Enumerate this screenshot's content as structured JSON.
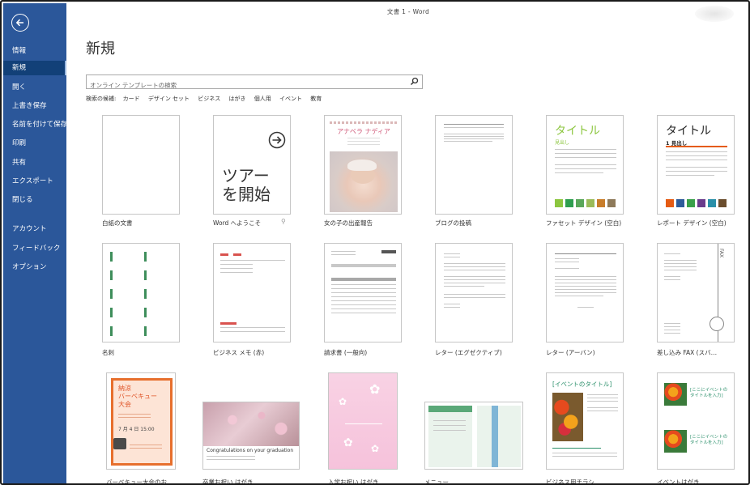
{
  "sidebar": {
    "back_label": "",
    "items": [
      {
        "label": "情報"
      },
      {
        "label": "新規"
      },
      {
        "label": "開く"
      },
      {
        "label": "上書き保存"
      },
      {
        "label": "名前を付けて保存"
      },
      {
        "label": "印刷"
      },
      {
        "label": "共有"
      },
      {
        "label": "エクスポート"
      },
      {
        "label": "閉じる"
      },
      {
        "label": "アカウント"
      },
      {
        "label": "フィードバック"
      },
      {
        "label": "オプション"
      }
    ],
    "active": "新規"
  },
  "window": {
    "title": "文書 1 - Word"
  },
  "page": {
    "title": "新規"
  },
  "search": {
    "placeholder": "オンライン テンプレートの検索"
  },
  "suggestions": {
    "label": "検索の候補:",
    "items": [
      "カード",
      "デザイン セット",
      "ビジネス",
      "はがき",
      "個人用",
      "イベント",
      "教育"
    ]
  },
  "templates": [
    {
      "label": "白紙の文書"
    },
    {
      "label": "Word へようこそ",
      "thumb_text_1": "ツアー",
      "thumb_text_2": "を開始"
    },
    {
      "label": "女の子の出産報告",
      "thumb_name": "アナベラ ナディア"
    },
    {
      "label": "ブログの投稿"
    },
    {
      "label": "ファセット デザイン (空白)",
      "thumb_title": "タイトル",
      "thumb_sub": "見出し"
    },
    {
      "label": "レポート デザイン (空白)",
      "thumb_title": "タイトル",
      "thumb_sub": "1  見出し"
    },
    {
      "label": "名刺"
    },
    {
      "label": "ビジネス メモ (赤)"
    },
    {
      "label": "請求書 (一般向)"
    },
    {
      "label": "レター (エグゼクティブ)"
    },
    {
      "label": "レター (アーバン)"
    },
    {
      "label": "差し込み FAX (スバ…"
    },
    {
      "label": "バーベキュー大会のお…",
      "thumb_title": "納涼\nバーベキュー\n大会",
      "thumb_date": "7 月 4 日 15:00"
    },
    {
      "label": "卒業お祝い はがき",
      "thumb_text": "Congratulations on your graduation"
    },
    {
      "label": "入学お祝い はがき"
    },
    {
      "label": "メニュー"
    },
    {
      "label": "ビジネス用チラシ",
      "thumb_title": "[イベントのタイトル]"
    },
    {
      "label": "イベントはがき",
      "thumb_title": "[ここにイベントのタイトルを入力]"
    }
  ],
  "colors": {
    "sidebar": "#2b579a",
    "accent_green": "#8cc63f",
    "report_orange": "#e55b13"
  }
}
